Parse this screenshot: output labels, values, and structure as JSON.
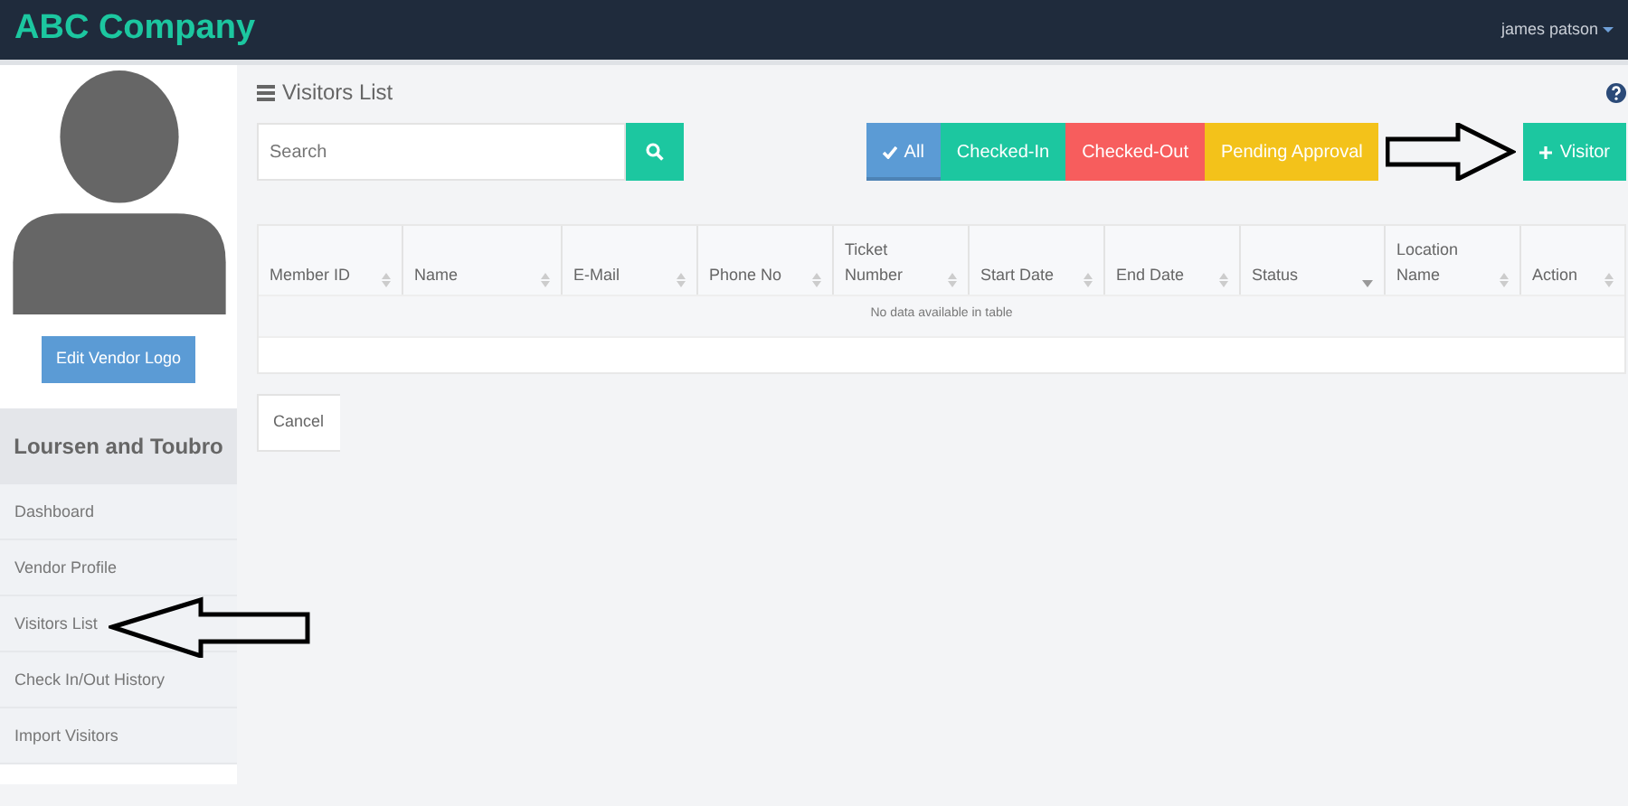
{
  "navbar": {
    "brand": "ABC Company",
    "user": "james patson"
  },
  "sidebar": {
    "button": "Edit Vendor Logo",
    "vendor": "Loursen and Toubro",
    "items": [
      "Dashboard",
      "Vendor Profile",
      "Visitors List",
      "Check In/Out History",
      "Import Visitors"
    ]
  },
  "page": {
    "title": "Visitors List",
    "search": {
      "placeholder": "Search"
    },
    "filters": [
      {
        "label": "All",
        "color": "#5b9bd5",
        "selected": true
      },
      {
        "label": "Checked-In",
        "color": "#1cc7a0",
        "selected": false
      },
      {
        "label": "Checked-Out",
        "color": "#f75d5d",
        "selected": false
      },
      {
        "label": "Pending Approval",
        "color": "#f3c21a",
        "selected": false
      }
    ],
    "add_button": "Visitor",
    "table": {
      "columns": [
        {
          "label": "Member ID",
          "kind": "sortable"
        },
        {
          "label": "Name",
          "kind": "sortable"
        },
        {
          "label": "E-Mail",
          "kind": "sortable"
        },
        {
          "label": "Phone No",
          "kind": "sortable"
        },
        {
          "label": "Ticket Number",
          "kind": "sortable"
        },
        {
          "label": "Start Date",
          "kind": "sortable"
        },
        {
          "label": "End Date",
          "kind": "sortable"
        },
        {
          "label": "Status",
          "kind": "sorted"
        },
        {
          "label": "Location Name",
          "kind": "sortable"
        },
        {
          "label": "Action",
          "kind": "sortable"
        }
      ],
      "empty_message": "No data available in table"
    },
    "cancel_button": "Cancel"
  }
}
